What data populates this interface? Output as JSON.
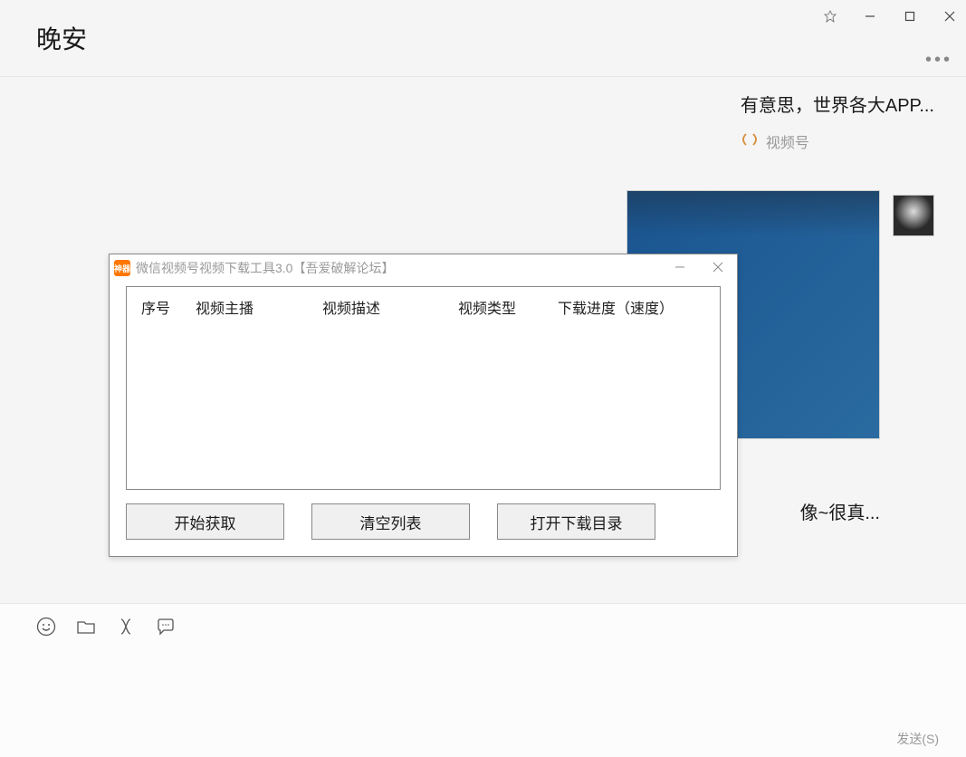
{
  "background": {
    "title": "晚安",
    "more": "•••",
    "chat": {
      "message1_text": "有意思，世界各大APP...",
      "video_label": "视频号",
      "truncated": "像~很真..."
    },
    "send_label": "发送(S)"
  },
  "dialog": {
    "icon_text": "神器",
    "title": "微信视频号视频下载工具3.0【吾爱破解论坛】",
    "columns": {
      "c1": "序号",
      "c2": "视频主播",
      "c3": "视频描述",
      "c4": "视频类型",
      "c5": "下载进度（速度）"
    },
    "buttons": {
      "start": "开始获取",
      "clear": "清空列表",
      "open": "打开下载目录"
    }
  }
}
